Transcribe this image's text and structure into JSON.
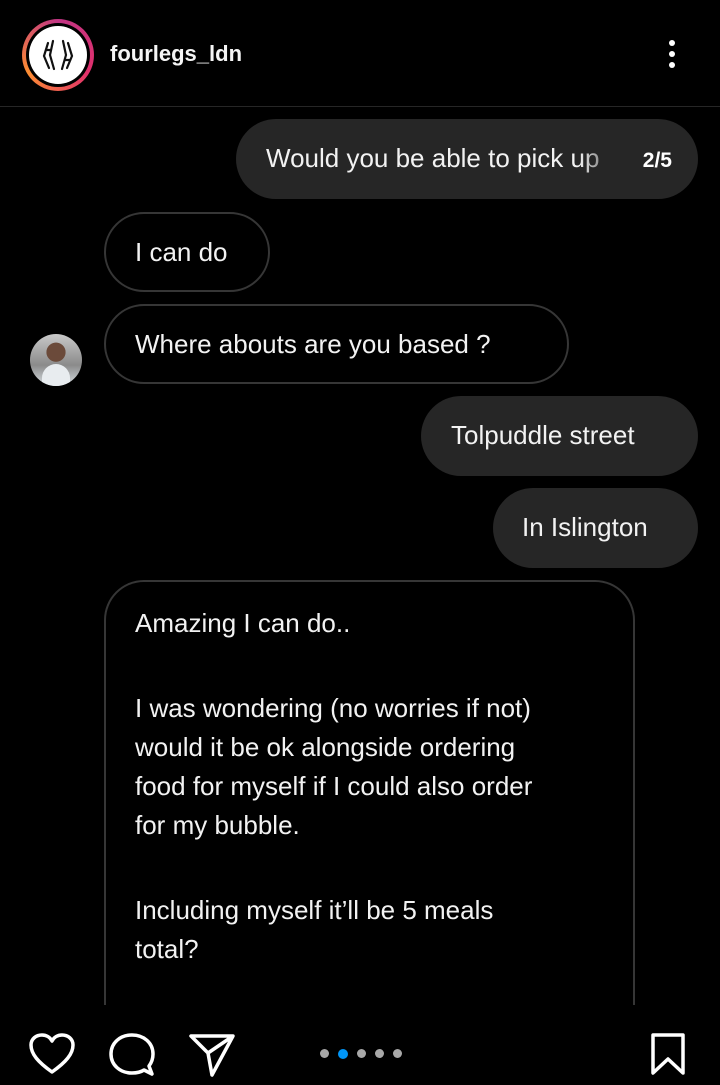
{
  "header": {
    "username": "fourlegs_ldn",
    "avatar_icon": "fourlegs-logo-icon",
    "more_icon": "more-vertical-icon"
  },
  "messages": [
    {
      "direction": "outgoing",
      "text": "Would you be able to pick up",
      "counter": "2/5"
    },
    {
      "direction": "incoming",
      "text": "I can do"
    },
    {
      "direction": "incoming",
      "text": "Where abouts are you based ?"
    },
    {
      "direction": "outgoing",
      "text": "Tolpuddle street"
    },
    {
      "direction": "outgoing",
      "text": "In Islington"
    }
  ],
  "long_message": {
    "paragraph1": "Amazing I can do..",
    "paragraph2_line1": "I was wondering (no worries if not)",
    "paragraph2_line2": "would it be ok alongside ordering",
    "paragraph2_line3": "food for myself if I could also order",
    "paragraph2_line4": "for my bubble.",
    "paragraph3_line1": "Including myself it’ll be 5 meals",
    "paragraph3_line2": "total?"
  },
  "footer": {
    "icons": [
      "heart-icon",
      "comment-icon",
      "send-icon",
      "bookmark-icon"
    ],
    "carousel": {
      "total": 5,
      "active_index": 1
    }
  },
  "colors": {
    "background": "#000000",
    "outgoing_bubble": "#262626",
    "incoming_border": "#363636",
    "carousel_active": "#0095f6"
  }
}
